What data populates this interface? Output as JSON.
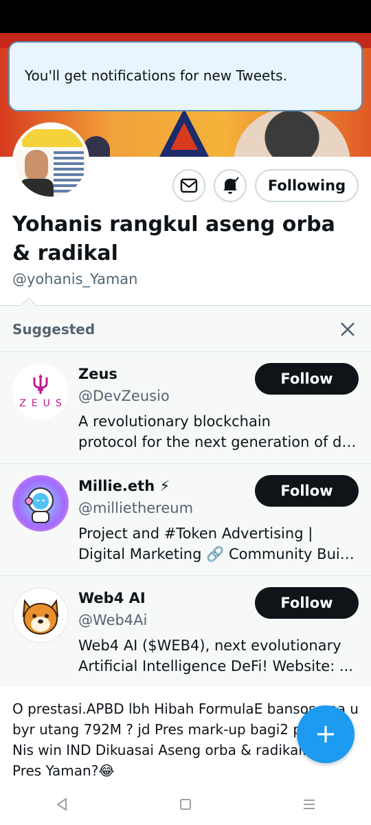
{
  "toast": {
    "message": "You'll get notifications for new Tweets."
  },
  "profile": {
    "name": "Yohanis rangkul aseng orba & radikal",
    "handle": "@yohanis_Yaman",
    "following_label": "Following"
  },
  "suggested": {
    "title": "Suggested",
    "items": [
      {
        "name": "Zeus",
        "handle": "@DevZeusio",
        "bio_line1": "A revolutionary blockchain",
        "bio_line2": "protocol for the next generation of di...",
        "follow_label": "Follow",
        "avatar_text": "ZEUS"
      },
      {
        "name": "Millie.eth ⚡",
        "handle": "@milliethereum",
        "bio_line1": "Project and #Token Advertising |",
        "bio_line2": "Digital Marketing 🔗 Community Buil...",
        "follow_label": "Follow"
      },
      {
        "name": "Web4 AI",
        "handle": "@Web4Ai",
        "bio_line1": "Web4 AI ($WEB4), next evolutionary",
        "bio_line2": "Artificial Intelligence DeFi!  Website: ...",
        "follow_label": "Follow"
      }
    ]
  },
  "tweet": {
    "text": "O prestasi.APBD lbh Hibah FormulaE bansos apa u byr utang 792M ? jd Pres  mark-up bagi2 proyek? Nis win IND Dikuasai Aseng orba & radikal. mau Pres Yaman?😂"
  },
  "colors": {
    "accent": "#1d9bf0",
    "follow_button": "#0f1419",
    "secondary_text": "#536471",
    "toast_bg": "#e8f5fd"
  }
}
